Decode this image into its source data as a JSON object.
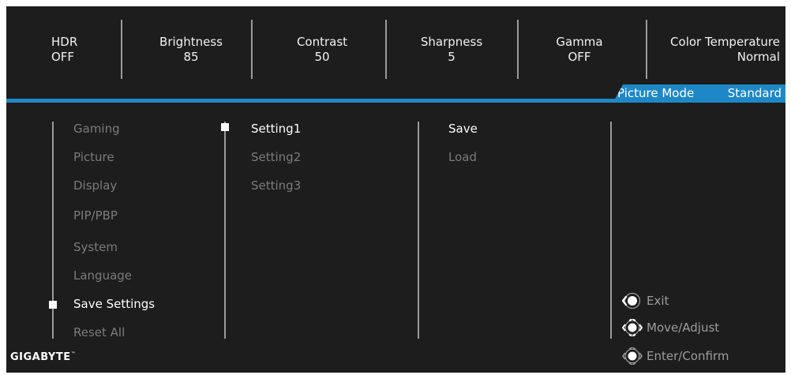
{
  "status_bar": [
    {
      "label": "HDR",
      "value": "OFF"
    },
    {
      "label": "Brightness",
      "value": "85"
    },
    {
      "label": "Contrast",
      "value": "50"
    },
    {
      "label": "Sharpness",
      "value": "5"
    },
    {
      "label": "Gamma",
      "value": "OFF"
    },
    {
      "label": "Color Temperature",
      "value": "Normal"
    }
  ],
  "picture_mode": {
    "label": "Picture Mode",
    "value": "Standard"
  },
  "main_menu": {
    "items": [
      "Gaming",
      "Picture",
      "Display",
      "PIP/PBP",
      "System",
      "Language",
      "Save Settings",
      "Reset All"
    ],
    "selected": "Save Settings"
  },
  "settings_menu": {
    "items": [
      "Setting1",
      "Setting2",
      "Setting3"
    ],
    "selected": "Setting1"
  },
  "action_menu": {
    "items": [
      "Save",
      "Load"
    ],
    "selected": "Save"
  },
  "footer": {
    "brand": "GIGABYTE",
    "trademark": "™",
    "hints": [
      {
        "icon": "joystick-left-icon",
        "label": "Exit"
      },
      {
        "icon": "joystick-all-directions-icon",
        "label": "Move/Adjust"
      },
      {
        "icon": "joystick-press-icon",
        "label": "Enter/Confirm"
      }
    ]
  },
  "colors": {
    "accent": "#1e88c7",
    "background": "#1d1d1d",
    "inactive_text": "#7b7b7b",
    "active_text": "#ffffff"
  }
}
